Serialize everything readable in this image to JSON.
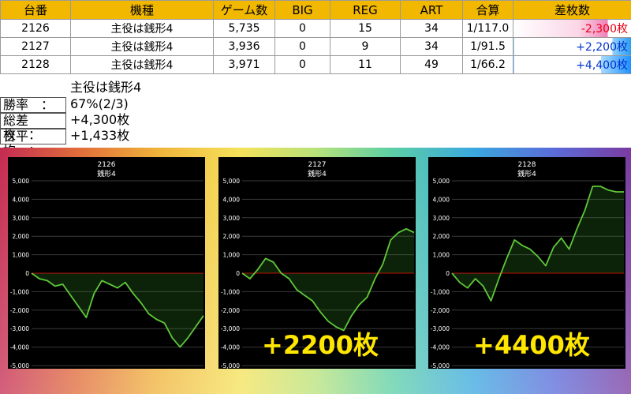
{
  "table": {
    "headers": [
      "台番",
      "機種",
      "ゲーム数",
      "BIG",
      "REG",
      "ART",
      "合算",
      "差枚数"
    ],
    "rows": [
      {
        "machine_no": "2126",
        "model": "主役は銭形4",
        "games": "5,735",
        "big": "0",
        "reg": "15",
        "art": "34",
        "combined": "1/117.0",
        "diff": "-2,300枚",
        "diff_sign": "neg"
      },
      {
        "machine_no": "2127",
        "model": "主役は銭形4",
        "games": "3,936",
        "big": "0",
        "reg": "9",
        "art": "34",
        "combined": "1/91.5",
        "diff": "+2,200枚",
        "diff_sign": "pos"
      },
      {
        "machine_no": "2128",
        "model": "主役は銭形4",
        "games": "3,971",
        "big": "0",
        "reg": "11",
        "art": "49",
        "combined": "1/66.2",
        "diff": "+4,400枚",
        "diff_sign": "pos"
      }
    ]
  },
  "summary": {
    "title": "主役は銭形4",
    "win_rate_label": "勝率　：",
    "win_rate_value": "67%(2/3)",
    "total_diff_label": "総差枚　：",
    "total_diff_value": "+4,300枚",
    "average_label": "台平均　：",
    "average_value": "+1,433枚"
  },
  "colors": {
    "header_bg": "#f2b800",
    "negative_text": "#e60012",
    "positive_text": "#0033cc",
    "line": "#5fc83a",
    "zero_line": "#cc0000",
    "overlay_text": "#ffe600"
  },
  "chart_data": [
    {
      "type": "line",
      "title": "2126",
      "subtitle": "銭形4",
      "yticks": [
        "5,000",
        "4,000",
        "3,000",
        "2,000",
        "1,000",
        "0",
        "-1,000",
        "-2,000",
        "-3,000",
        "-4,000",
        "-5,000"
      ],
      "ylim": [
        -5000,
        5000
      ],
      "x": [
        0,
        0.5,
        1,
        1.5,
        2,
        2.5,
        3,
        3.5,
        4,
        4.5,
        5,
        5.5,
        6,
        6.5,
        7,
        7.5,
        8,
        8.5,
        9,
        9.5,
        10,
        10.5,
        11
      ],
      "values": [
        0,
        -300,
        -400,
        -700,
        -600,
        -1200,
        -1800,
        -2400,
        -1100,
        -400,
        -600,
        -800,
        -500,
        -1100,
        -1600,
        -2200,
        -2500,
        -2700,
        -3500,
        -4000,
        -3500,
        -2900,
        -2300
      ]
    },
    {
      "type": "line",
      "title": "2127",
      "subtitle": "銭形4",
      "yticks": [
        "5,000",
        "4,000",
        "3,000",
        "2,000",
        "1,000",
        "0",
        "-1,000",
        "-2,000",
        "-3,000",
        "-4,000",
        "-5,000"
      ],
      "ylim": [
        -5000,
        5000
      ],
      "x": [
        0,
        0.5,
        1,
        1.5,
        2,
        2.5,
        3,
        3.5,
        4,
        4.5,
        5,
        5.5,
        6,
        6.5,
        7,
        7.5,
        8,
        8.5,
        9,
        9.5,
        10,
        10.5,
        11
      ],
      "values": [
        0,
        -300,
        200,
        800,
        600,
        0,
        -300,
        -900,
        -1200,
        -1500,
        -2100,
        -2600,
        -2900,
        -3100,
        -2300,
        -1700,
        -1300,
        -300,
        500,
        1800,
        2200,
        2400,
        2200
      ],
      "overlay": "+2200枚"
    },
    {
      "type": "line",
      "title": "2128",
      "subtitle": "銭形4",
      "yticks": [
        "5,000",
        "4,000",
        "3,000",
        "2,000",
        "1,000",
        "0",
        "-1,000",
        "-2,000",
        "-3,000",
        "-4,000",
        "-5,000"
      ],
      "ylim": [
        -5000,
        5000
      ],
      "x": [
        0,
        0.5,
        1,
        1.5,
        2,
        2.5,
        3,
        3.5,
        4,
        4.5,
        5,
        5.5,
        6,
        6.5,
        7,
        7.5,
        8,
        8.5,
        9,
        9.5,
        10,
        10.5,
        11
      ],
      "values": [
        0,
        -500,
        -800,
        -300,
        -700,
        -1500,
        -300,
        800,
        1800,
        1500,
        1300,
        900,
        400,
        1400,
        1900,
        1300,
        2400,
        3400,
        4700,
        4700,
        4500,
        4400,
        4400
      ],
      "overlay": "+4400枚"
    }
  ]
}
